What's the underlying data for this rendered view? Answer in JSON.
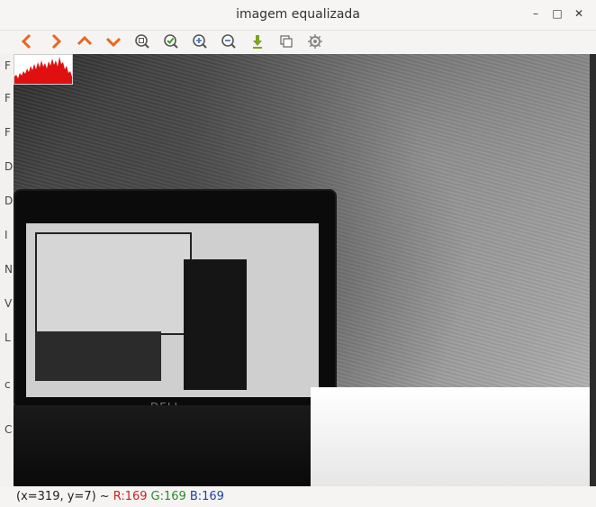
{
  "window": {
    "title": "imagem equalizada"
  },
  "toolbar": {
    "buttons": [
      {
        "name": "pan-left-button",
        "icon": "chevron-left-icon"
      },
      {
        "name": "pan-right-button",
        "icon": "chevron-right-icon"
      },
      {
        "name": "pan-up-button",
        "icon": "chevron-up-icon"
      },
      {
        "name": "pan-down-button",
        "icon": "chevron-down-icon"
      },
      {
        "name": "zoom-fit-button",
        "icon": "zoom-fit-icon"
      },
      {
        "name": "zoom-original-button",
        "icon": "zoom-check-icon"
      },
      {
        "name": "zoom-in-button",
        "icon": "zoom-in-icon"
      },
      {
        "name": "zoom-out-button",
        "icon": "zoom-out-icon"
      },
      {
        "name": "save-button",
        "icon": "download-arrow-icon"
      },
      {
        "name": "copy-button",
        "icon": "copy-icon"
      },
      {
        "name": "properties-button",
        "icon": "gear-icon"
      }
    ]
  },
  "left_strip": {
    "letters": [
      "F",
      "F",
      "F",
      "D",
      "D",
      "I",
      "N",
      "V",
      "L",
      "c",
      "C"
    ]
  },
  "image": {
    "laptop_logo": "DELL"
  },
  "status": {
    "coords": "(x=319, y=7) ~",
    "r": "R:169",
    "g": "G:169",
    "b": "B:169"
  },
  "colors": {
    "toolbar_orange": "#e8671c",
    "zoom_blue": "#4a79c2",
    "zoom_check_green": "#3d9b2f",
    "download_green": "#7aa520"
  }
}
